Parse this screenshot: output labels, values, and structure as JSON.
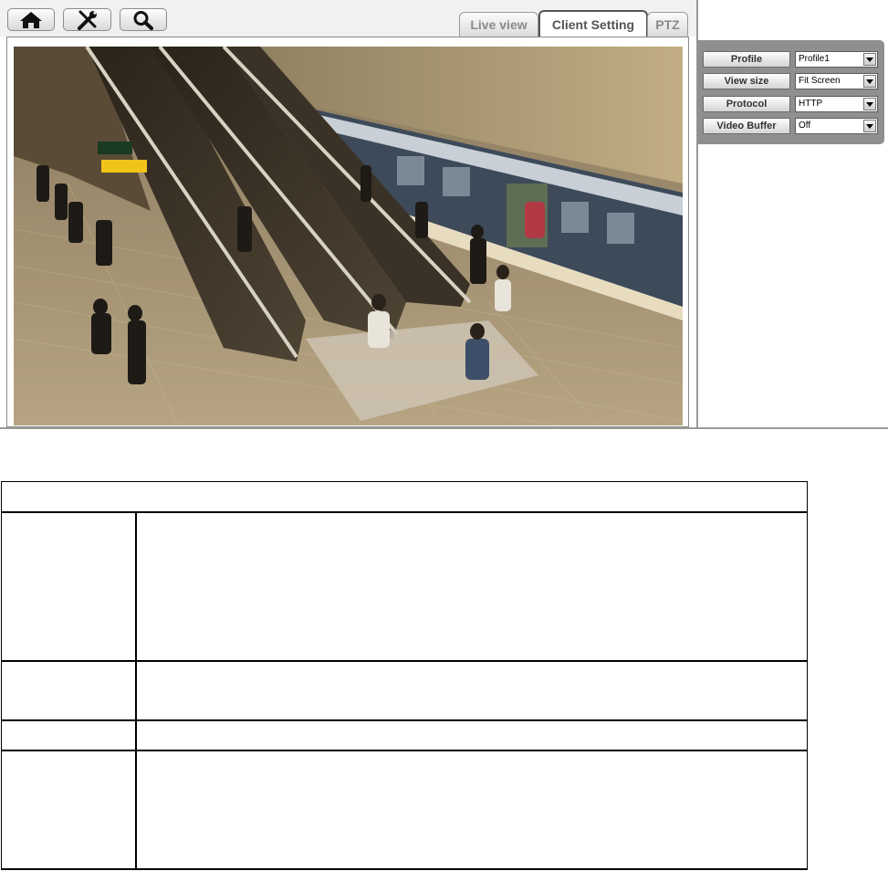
{
  "toolbar": {
    "icons": [
      "home-icon",
      "tools-icon",
      "search-icon"
    ]
  },
  "tabs": [
    {
      "label": "Live view",
      "active": false
    },
    {
      "label": "Client Setting",
      "active": true
    },
    {
      "label": "PTZ",
      "active": false
    }
  ],
  "settings": {
    "profile": {
      "label": "Profile",
      "value": "Profile1"
    },
    "view_size": {
      "label": "View size",
      "value": "Fit Screen"
    },
    "protocol": {
      "label": "Protocol",
      "value": "HTTP"
    },
    "video_buffer": {
      "label": "Video Buffer",
      "value": "Off"
    }
  },
  "colors": {
    "panel": "#8f8f8f",
    "active_tab_text": "#555555",
    "inactive_tab_text": "#8a8a8a"
  }
}
